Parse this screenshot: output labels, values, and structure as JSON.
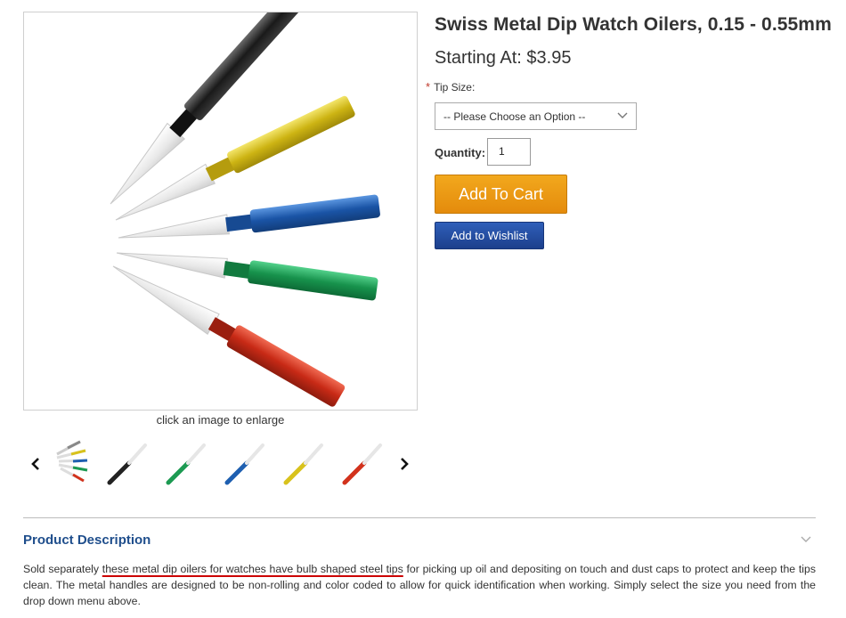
{
  "product": {
    "title": "Swiss Metal Dip Watch Oilers, 0.15 - 0.55mm",
    "price_text": "Starting At: $3.95"
  },
  "gallery": {
    "enlarge_hint": "click an image to enlarge",
    "prev_icon": "chevron-left-icon",
    "next_icon": "chevron-right-icon",
    "thumbnails": [
      "multi",
      "black",
      "green",
      "blue",
      "yellow",
      "red"
    ]
  },
  "options": {
    "required_mark": "*",
    "tip_size_label": "Tip Size:",
    "tip_size_selected": "-- Please Choose an Option --"
  },
  "quantity": {
    "label": "Quantity:",
    "value": "1"
  },
  "actions": {
    "add_to_cart": "Add To Cart",
    "add_to_wishlist": "Add to Wishlist"
  },
  "description": {
    "heading": "Product Description",
    "text_before": "Sold separately ",
    "text_highlight": "these metal dip oilers for watches have bulb shaped steel tips",
    "text_after": " for picking up oil and depositing on touch and dust caps to protect and keep the tips clean. The metal handles are designed to be non-rolling and color coded to allow for quick identification when working. Simply select the size you need from the drop down menu above."
  },
  "colors": {
    "add_to_cart_bg": "#ec9b14",
    "wishlist_bg": "#2550a3",
    "heading_blue": "#1f4e8c",
    "required_red": "#c0392b",
    "oiler_black": "#2a2a2a",
    "oiler_yellow": "#d8c21c",
    "oiler_blue": "#1e5fb0",
    "oiler_green": "#1c9a52",
    "oiler_red": "#d2321c"
  }
}
